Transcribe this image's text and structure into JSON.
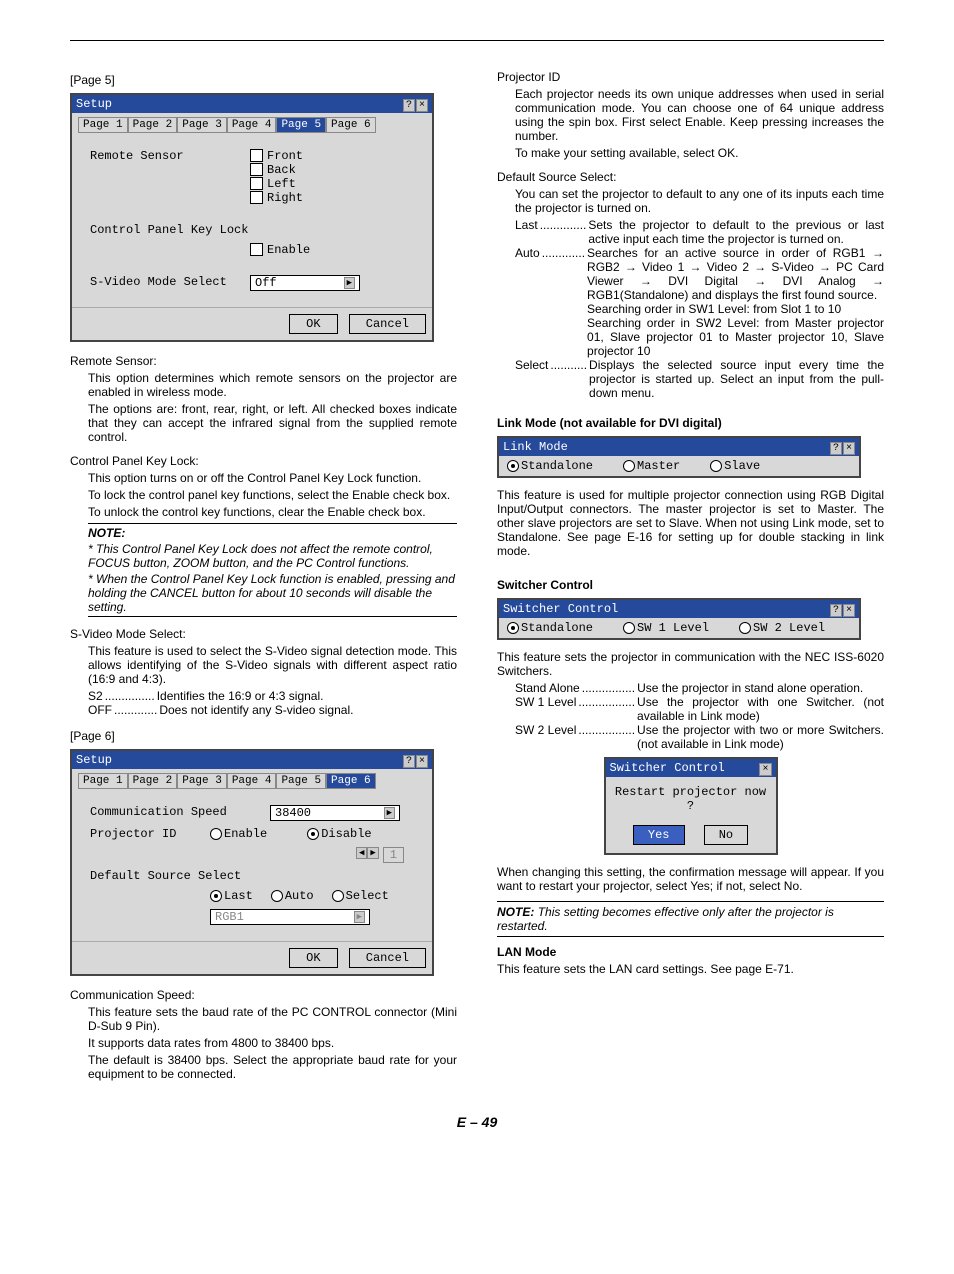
{
  "left": {
    "page5_label": "[Page 5]",
    "setup_title": "Setup",
    "tabs": [
      "Page 1",
      "Page 2",
      "Page 3",
      "Page 4",
      "Page 5",
      "Page 6"
    ],
    "remote_sensor_label": "Remote Sensor",
    "remote_sensor_opts": [
      "Front",
      "Back",
      "Left",
      "Right"
    ],
    "cpkl_label": "Control Panel Key Lock",
    "enable_label": "Enable",
    "svideo_label": "S-Video Mode Select",
    "svideo_value": "Off",
    "ok": "OK",
    "cancel": "Cancel",
    "remote_sensor_hdr": "Remote Sensor:",
    "remote_sensor_p1": "This option determines which remote sensors on the projector are enabled in wireless mode.",
    "remote_sensor_p2": "The options are: front, rear, right, or left. All checked boxes indicate that they can accept the infrared signal from the supplied remote control.",
    "cpkl_hdr": "Control Panel Key Lock:",
    "cpkl_p1": "This option turns on or off the Control Panel Key Lock function.",
    "cpkl_p2": "To lock the control panel key functions, select the Enable check box.",
    "cpkl_p3": "To unlock the control key functions, clear the Enable check box.",
    "note_label": "NOTE:",
    "note1": "* This Control Panel Key Lock does not affect the remote control, FOCUS button, ZOOM button, and the PC Control functions.",
    "note2": "* When the Control Panel Key Lock function is enabled, pressing and holding the CANCEL button for about 10 seconds will disable the setting.",
    "svideo_hdr": "S-Video Mode Select:",
    "svideo_p1": "This feature is used to select the S-Video signal detection mode. This allows identifying of the S-Video signals with different aspect ratio (16:9 and 4:3).",
    "svideo_s2_k": "S2",
    "svideo_s2_v": "Identifies the 16:9 or 4:3 signal.",
    "svideo_off_k": "OFF",
    "svideo_off_v": "Does not identify any S-video signal.",
    "page6_label": "[Page 6]",
    "comm_speed_label": "Communication Speed",
    "comm_speed_value": "38400",
    "proj_id_label": "Projector ID",
    "proj_enable": "Enable",
    "proj_disable": "Disable",
    "proj_id_value": "1",
    "dss_label": "Default Source Select",
    "dss_last": "Last",
    "dss_auto": "Auto",
    "dss_select": "Select",
    "dss_value": "RGB1",
    "comm_speed_hdr": "Communication Speed:",
    "comm_speed_p1": "This feature sets the baud rate of the PC CONTROL connector (Mini D-Sub 9 Pin).",
    "comm_speed_p2": "It supports data rates from 4800 to 38400 bps.",
    "comm_speed_p3": "The default is 38400 bps. Select the appropriate baud rate for your equipment to be connected."
  },
  "right": {
    "projid_hdr": "Projector ID",
    "projid_p1": "Each projector needs its own unique addresses when used in serial communication mode. You can choose one of 64 unique address using the spin box. First select Enable. Keep pressing increases the number.",
    "projid_p2": "To make your setting available, select OK.",
    "dss_hdr": "Default Source Select:",
    "dss_p1": "You can set the projector to default to any one of its inputs each time the projector is turned on.",
    "dss_last_k": "Last",
    "dss_last_v": "Sets the projector to default to the previous or last active input each time the projector is turned on.",
    "dss_auto_k": "Auto",
    "dss_auto_v": "Searches for an active source in order of RGB1 → RGB2 → Video 1 → Video 2 → S-Video → PC Card Viewer → DVI Digital → DVI Analog → RGB1(Standalone) and displays the first found source.",
    "dss_auto_v2": "Searching order in SW1 Level: from Slot 1 to 10",
    "dss_auto_v3": "Searching order in SW2 Level: from Master projector 01, Slave projector 01 to Master projector 10, Slave projector 10",
    "dss_select_k": "Select",
    "dss_select_v": "Displays the selected source input every time the projector is started up. Select an input from the pull-down menu.",
    "linkmode_hdr": "Link Mode (not available for DVI digital)",
    "linkmode_title": "Link Mode",
    "lm_standalone": "Standalone",
    "lm_master": "Master",
    "lm_slave": "Slave",
    "linkmode_p": "This feature is used for multiple projector connection using RGB Digital Input/Output connectors. The master projector is set to Master. The other slave projectors are set to Slave. When not using Link mode, set to Standalone. See page E-16 for setting up for double stacking in link mode.",
    "switcher_hdr": "Switcher Control",
    "sw_title": "Switcher Control",
    "sw_standalone": "Standalone",
    "sw_sw1": "SW 1 Level",
    "sw_sw2": "SW 2 Level",
    "switcher_p1": "This feature sets the projector in communication with the NEC ISS-6020 Switchers.",
    "sw_sa_k": "Stand Alone",
    "sw_sa_v": "Use the projector in stand alone operation.",
    "sw_sw1_k": "SW 1 Level",
    "sw_sw1_v": "Use the projector with one Switcher. (not available in Link mode)",
    "sw_sw2_k": "SW 2 Level",
    "sw_sw2_v": "Use the projector with two or more Switchers. (not available in Link mode)",
    "confirm_title": "Switcher Control",
    "confirm_msg": "Restart projector now ?",
    "confirm_yes": "Yes",
    "confirm_no": "No",
    "switcher_p2": "When changing this setting, the confirmation message will appear. If you want to restart your projector, select Yes; if not, select No.",
    "note_effective": "NOTE: This setting becomes effective only after the projector is restarted.",
    "lan_hdr": "LAN Mode",
    "lan_p": "This feature sets the LAN card settings. See page E-71."
  },
  "footer": "E – 49"
}
